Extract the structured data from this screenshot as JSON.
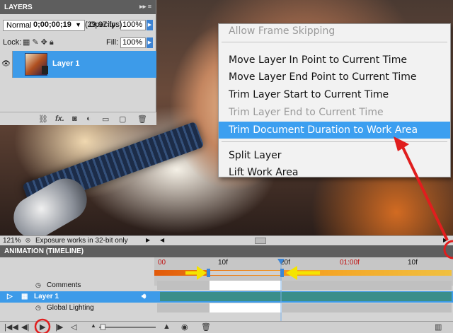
{
  "layers_panel": {
    "title": "LAYERS",
    "blend_mode": "Normal",
    "opacity_label": "Opacity:",
    "opacity_value": "100%",
    "lock_label": "Lock:",
    "fill_label": "Fill:",
    "fill_value": "100%",
    "layer_name": "Layer 1"
  },
  "context_menu": {
    "items": [
      {
        "label": "Allow Frame Skipping",
        "state": "disabled"
      },
      {
        "label": "Move Layer In Point to Current Time",
        "state": "enabled"
      },
      {
        "label": "Move Layer End Point to Current Time",
        "state": "enabled"
      },
      {
        "label": "Trim Layer Start to Current Time",
        "state": "enabled"
      },
      {
        "label": "Trim Layer End to Current Time",
        "state": "disabled"
      },
      {
        "label": "Trim Document Duration to Work Area",
        "state": "selected"
      },
      {
        "label": "Split Layer",
        "state": "enabled"
      },
      {
        "label": "Lift Work Area",
        "state": "enabled"
      }
    ]
  },
  "status_bar": {
    "zoom": "121%",
    "message": "Exposure works in 32-bit only"
  },
  "timeline": {
    "title": "ANIMATION (TIMELINE)",
    "timecode": "0;00;00;19",
    "fps": "(29.97 fps)",
    "ruler_ticks": [
      "00",
      "10f",
      "20f",
      "01:00f",
      "10f"
    ],
    "rows": [
      {
        "name": "Comments"
      },
      {
        "name": "Layer 1"
      },
      {
        "name": "Global Lighting"
      }
    ]
  },
  "colors": {
    "selection_blue": "#3c9ff0",
    "annotation_red": "#e01e1e",
    "annotation_yellow": "#f5e400"
  }
}
